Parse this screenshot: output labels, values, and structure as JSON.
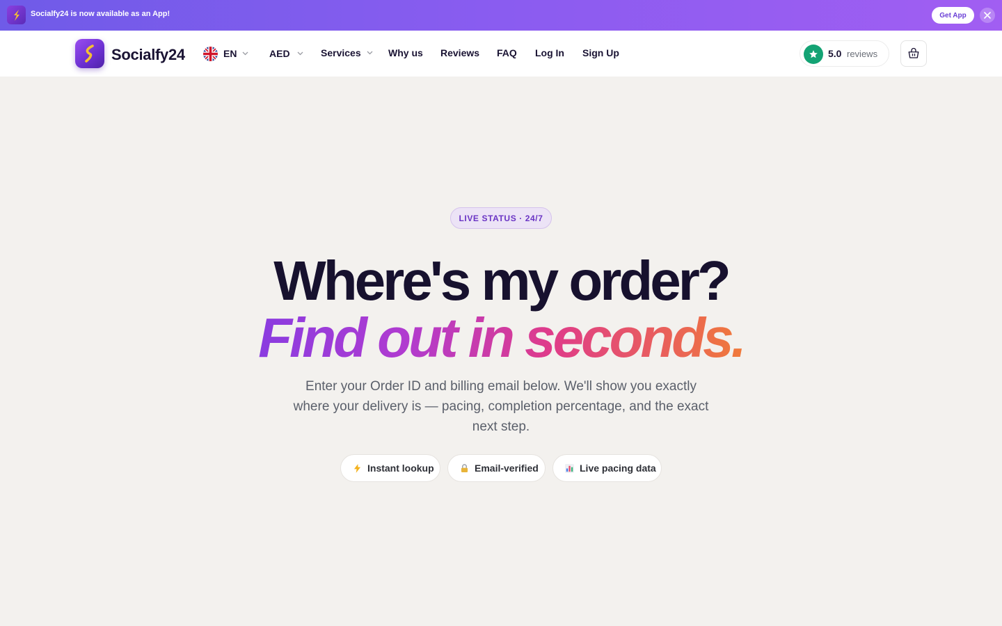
{
  "banner": {
    "text": "Socialfy24 is now available as an App!",
    "cta_label": "Get App"
  },
  "nav": {
    "brand": "Socialfy24",
    "language": "EN",
    "currency": "AED",
    "links": [
      "Services",
      "Why us",
      "Reviews",
      "FAQ",
      "Log In",
      "Sign Up"
    ],
    "rating": "5.0",
    "reviews_label": "reviews"
  },
  "hero": {
    "badge": "LIVE STATUS · 24/7",
    "title_line1": "Where's my order?",
    "title_line2": "Find out in seconds.",
    "subtitle": "Enter your Order ID and billing email below. We'll show you exactly where your delivery is — pacing, completion percentage, and the exact next step.",
    "features": [
      {
        "icon": "lightning-icon",
        "label": "Instant lookup"
      },
      {
        "icon": "lock-icon",
        "label": "Email-verified"
      },
      {
        "icon": "bar-chart-icon",
        "label": "Live pacing data"
      }
    ]
  },
  "colors": {
    "brand_purple": "#6f5be8",
    "accent_green": "#14a374",
    "gradient_start": "#8a3ce0",
    "gradient_end": "#f07a3a"
  }
}
